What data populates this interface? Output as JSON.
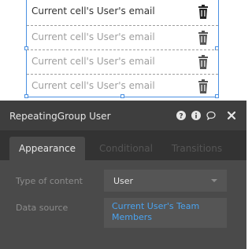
{
  "repeating_group": {
    "rows": [
      {
        "text": "Current cell's User's email"
      },
      {
        "text": "Current cell's User's email"
      },
      {
        "text": "Current cell's User's email"
      },
      {
        "text": "Current cell's User's email"
      }
    ],
    "row_action_icon": "trash-icon"
  },
  "panel": {
    "title": "RepeatingGroup User",
    "header_icons": [
      "help-icon",
      "info-icon",
      "comment-icon",
      "close-icon"
    ],
    "tabs": [
      {
        "label": "Appearance",
        "active": true
      },
      {
        "label": "Conditional",
        "active": false
      },
      {
        "label": "Transitions",
        "active": false
      }
    ],
    "fields": {
      "type_of_content": {
        "label": "Type of content",
        "value": "User"
      },
      "data_source": {
        "label": "Data source",
        "value": "Current User's Team Members"
      }
    }
  },
  "colors": {
    "selection": "#4a90e2",
    "panel_bg": "#3e3e3e",
    "link": "#4aa3f0"
  }
}
